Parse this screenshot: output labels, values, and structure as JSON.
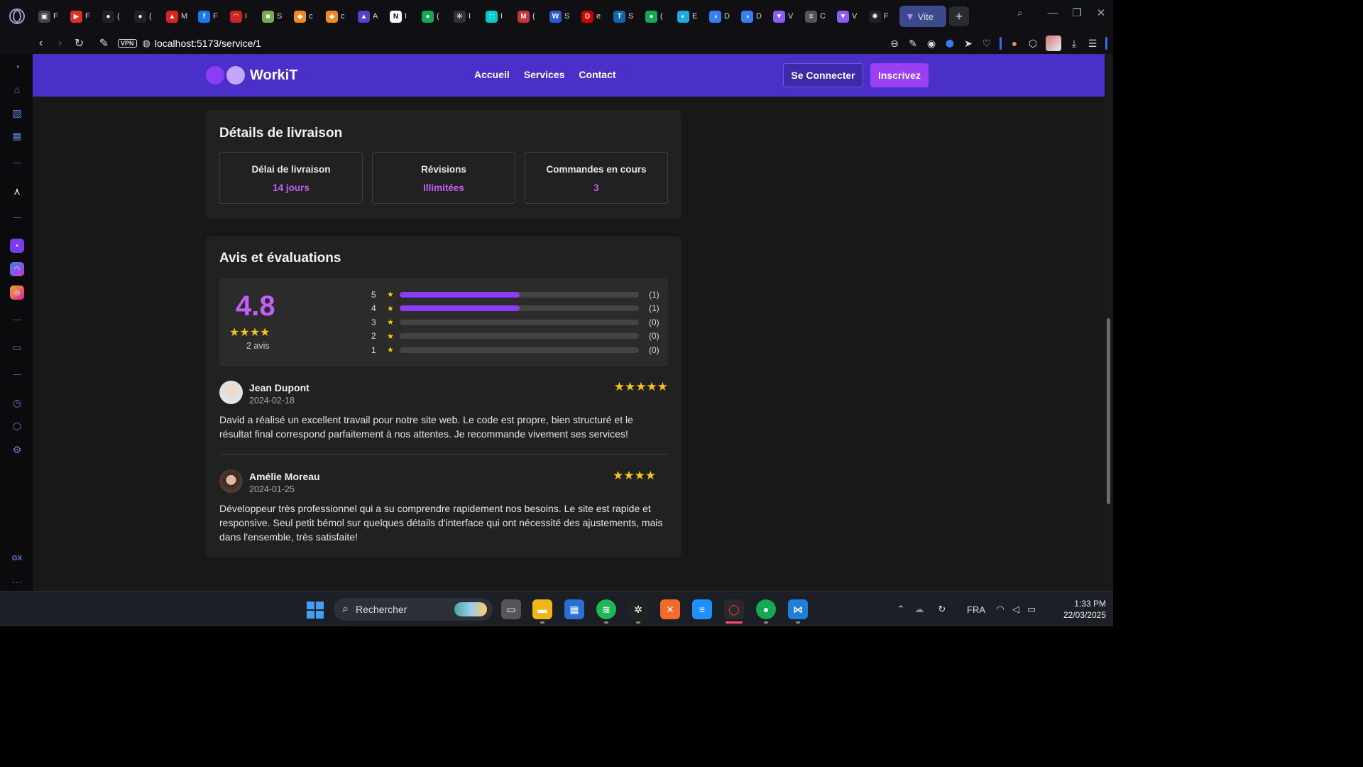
{
  "browser": {
    "tabs": [
      {
        "icon": "gamepad-icon",
        "color": "#444",
        "title": "F",
        "glyph": "▣"
      },
      {
        "icon": "youtube-icon",
        "color": "#e52d27",
        "title": "F",
        "glyph": "▶"
      },
      {
        "icon": "github-icon",
        "color": "#222",
        "title": "(",
        "glyph": "●"
      },
      {
        "icon": "github-icon",
        "color": "#222",
        "title": "(",
        "glyph": "●"
      },
      {
        "icon": "cap-icon",
        "color": "#d22",
        "title": "M",
        "glyph": "▲"
      },
      {
        "icon": "facebook-icon",
        "color": "#1877f2",
        "title": "F",
        "glyph": "f"
      },
      {
        "icon": "arc-icon",
        "color": "#c22",
        "title": "I",
        "glyph": "◠"
      },
      {
        "icon": "portrait-icon",
        "color": "#7a5",
        "title": "S",
        "glyph": "■"
      },
      {
        "icon": "bitbucket-icon",
        "color": "#f08a1d",
        "title": "c",
        "glyph": "◆"
      },
      {
        "icon": "bitbucket-icon",
        "color": "#f08a1d",
        "title": "c",
        "glyph": "◆"
      },
      {
        "icon": "triangle-icon",
        "color": "#5a3fc9",
        "title": "A",
        "glyph": "▲"
      },
      {
        "icon": "notion-icon",
        "color": "#fff",
        "title": "I",
        "glyph": "N"
      },
      {
        "icon": "mongodb-icon",
        "color": "#13aa52",
        "title": "(",
        "glyph": "●"
      },
      {
        "icon": "chatgpt-icon",
        "color": "#333",
        "title": "I",
        "glyph": "✲"
      },
      {
        "icon": "devtool-icon",
        "color": "#0cc",
        "title": "I",
        "glyph": "□"
      },
      {
        "icon": "gmail-icon",
        "color": "#c33",
        "title": "(",
        "glyph": "M"
      },
      {
        "icon": "word-icon",
        "color": "#2b5bd6",
        "title": "S",
        "glyph": "W"
      },
      {
        "icon": "deezer-icon",
        "color": "#c00",
        "title": "e",
        "glyph": "D"
      },
      {
        "icon": "tailwind-icon",
        "color": "#16a",
        "title": "S",
        "glyph": "T"
      },
      {
        "icon": "mongodb-icon",
        "color": "#13aa52",
        "title": "(",
        "glyph": "●"
      },
      {
        "icon": "vercel-icon",
        "color": "#2ad",
        "title": "E",
        "glyph": "◐"
      },
      {
        "icon": "webstorm-icon",
        "color": "#3a7df0",
        "title": "D",
        "glyph": "◑"
      },
      {
        "icon": "webstorm-icon",
        "color": "#3a7df0",
        "title": "D",
        "glyph": "◑"
      },
      {
        "icon": "vite-icon",
        "color": "#8b5cf6",
        "title": "V",
        "glyph": "▼"
      },
      {
        "icon": "settings-tab-icon",
        "color": "#555",
        "title": "C",
        "glyph": "≡"
      },
      {
        "icon": "vite-icon",
        "color": "#8b5cf6",
        "title": "V",
        "glyph": "▼"
      },
      {
        "icon": "react-icon",
        "color": "#222",
        "title": "F",
        "glyph": "✺"
      }
    ],
    "active_tab": {
      "icon": "vite-icon",
      "title": "Vite"
    },
    "new_tab": "+",
    "url": "localhost:5173/service/1",
    "vpn_label": "VPN"
  },
  "header": {
    "brand": "WorkiT",
    "nav": [
      "Accueil",
      "Services",
      "Contact"
    ],
    "login": "Se Connecter",
    "signup": "Inscrivez"
  },
  "delivery": {
    "title": "Détails de livraison",
    "items": [
      {
        "label": "Délai de livraison",
        "value": "14 jours"
      },
      {
        "label": "Révisions",
        "value": "Illimitées"
      },
      {
        "label": "Commandes en cours",
        "value": "3"
      }
    ]
  },
  "reviews": {
    "title": "Avis et évaluations",
    "average": "4.8",
    "average_stars": "★★★★",
    "count_label": "2 avis",
    "distribution": [
      {
        "stars": "5",
        "count": "(1)",
        "fraction": 0.5
      },
      {
        "stars": "4",
        "count": "(1)",
        "fraction": 0.5
      },
      {
        "stars": "3",
        "count": "(0)",
        "fraction": 0
      },
      {
        "stars": "2",
        "count": "(0)",
        "fraction": 0
      },
      {
        "stars": "1",
        "count": "(0)",
        "fraction": 0
      }
    ],
    "items": [
      {
        "name": "Jean Dupont",
        "date": "2024-02-18",
        "stars": "★★★★★",
        "rating": 5,
        "text": "David a réalisé un excellent travail pour notre site web. Le code est propre, bien structuré et le résultat final correspond parfaitement à nos attentes. Je recommande vivement ses services!"
      },
      {
        "name": "Amélie Moreau",
        "date": "2024-01-25",
        "stars": "★★★★",
        "rating": 4,
        "text": "Développeur très professionnel qui a su comprendre rapidement nos besoins. Le site est rapide et responsive. Seul petit bémol sur quelques détails d'interface qui ont nécessité des ajustements, mais dans l'ensemble, très satisfaite!"
      }
    ]
  },
  "taskbar": {
    "search_placeholder": "Rechercher",
    "language": "FRA",
    "time": "1:33 PM",
    "date": "22/03/2025"
  },
  "sidebar": {
    "bottom_label": "GX",
    "more": "···"
  },
  "colors": {
    "header": "#4a2fc9",
    "accent": "#c25ff5",
    "bar_fill": "#8b3cf5",
    "star": "#f5c518"
  }
}
